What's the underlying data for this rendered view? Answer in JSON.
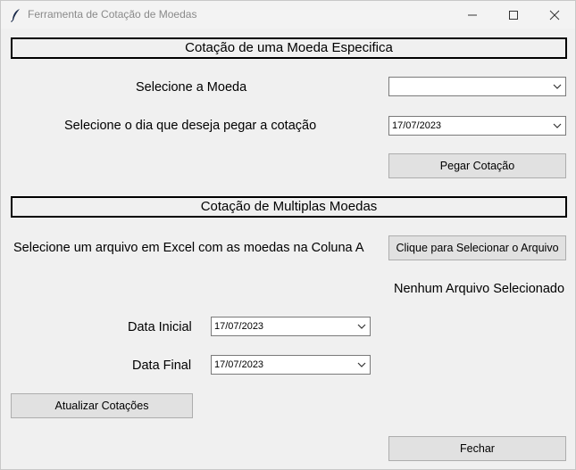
{
  "window": {
    "title": "Ferramenta de Cotação de Moedas"
  },
  "single": {
    "heading": "Cotação de uma Moeda Especifica",
    "currency_label": "Selecione a Moeda",
    "currency_value": "",
    "date_label": "Selecione o dia que deseja pegar a cotação",
    "date_value": "17/07/2023",
    "button": "Pegar Cotação"
  },
  "multi": {
    "heading": "Cotação de Multiplas Moedas",
    "file_label": "Selecione um arquivo em Excel com as moedas na Coluna A",
    "file_button": "Clique para Selecionar o Arquivo",
    "file_status": "Nenhum Arquivo Selecionado",
    "start_label": "Data Inicial",
    "start_value": "17/07/2023",
    "end_label": "Data Final",
    "end_value": "17/07/2023",
    "update_button": "Atualizar Cotações"
  },
  "footer": {
    "close_button": "Fechar"
  }
}
